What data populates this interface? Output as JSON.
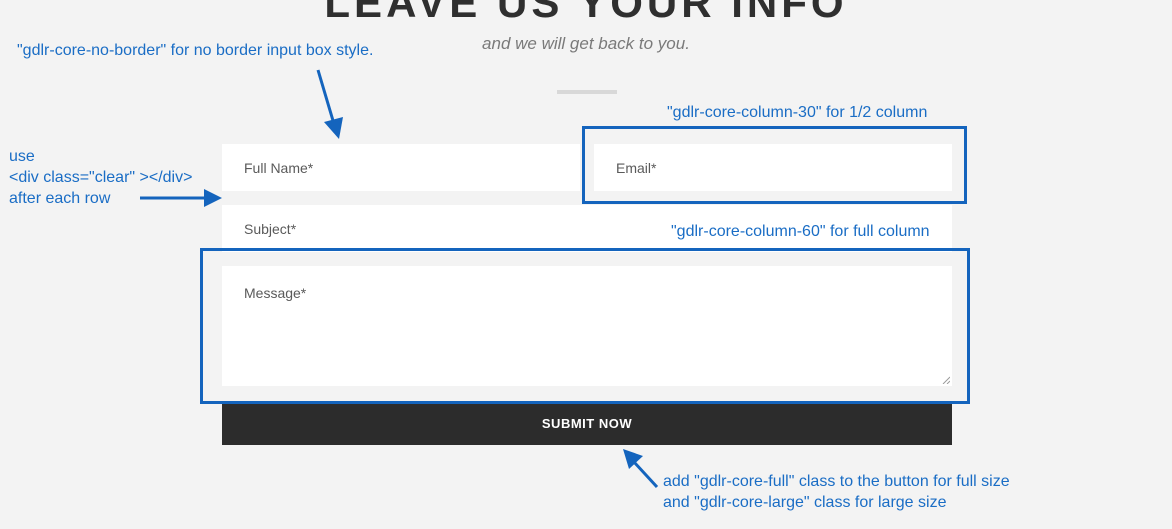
{
  "header": {
    "title": "LEAVE US YOUR INFO",
    "subtitle": "and we will get back to you."
  },
  "form": {
    "full_name_placeholder": "Full Name*",
    "email_placeholder": "Email*",
    "subject_placeholder": "Subject*",
    "message_placeholder": "Message*",
    "submit_label": "SUBMIT NOW"
  },
  "annotations": {
    "no_border": "\"gdlr-core-no-border\" for no border input box style.",
    "column_30": "\"gdlr-core-column-30\" for 1/2 column",
    "column_60": "\"gdlr-core-column-60\" for full column",
    "clear_line1": "use",
    "clear_line2": "<div class=\"clear\" ></div>",
    "clear_line3": "after each row",
    "button_line1": "add \"gdlr-core-full\" class to the button for full size",
    "button_line2": "and \"gdlr-core-large\" class for large size"
  },
  "colors": {
    "background": "#f3f3f3",
    "annotation_blue": "#1a6dc5",
    "highlight_border": "#1464bd",
    "button_bg": "#2c2c2c"
  }
}
